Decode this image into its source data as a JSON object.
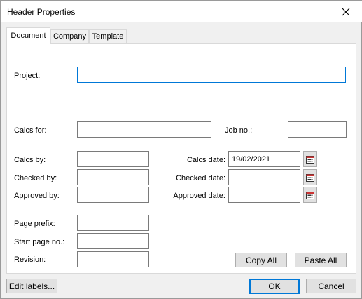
{
  "window": {
    "title": "Header Properties",
    "close_icon": "close-icon"
  },
  "tabs": [
    {
      "label": "Document",
      "active": true
    },
    {
      "label": "Company",
      "active": false
    },
    {
      "label": "Template",
      "active": false
    }
  ],
  "fields": {
    "project": {
      "label": "Project:",
      "value": ""
    },
    "calcs_for": {
      "label": "Calcs for:",
      "value": ""
    },
    "job_no": {
      "label": "Job no.:",
      "value": ""
    },
    "calcs_by": {
      "label": "Calcs by:",
      "value": ""
    },
    "checked_by": {
      "label": "Checked by:",
      "value": ""
    },
    "approved_by": {
      "label": "Approved by:",
      "value": ""
    },
    "calcs_date": {
      "label": "Calcs date:",
      "value": "19/02/2021"
    },
    "checked_date": {
      "label": "Checked date:",
      "value": ""
    },
    "approved_date": {
      "label": "Approved date:",
      "value": ""
    },
    "page_prefix": {
      "label": "Page prefix:",
      "value": ""
    },
    "start_page_no": {
      "label": "Start page no.:",
      "value": ""
    },
    "revision": {
      "label": "Revision:",
      "value": ""
    }
  },
  "buttons": {
    "copy_all": "Copy All",
    "paste_all": "Paste All",
    "edit_labels": "Edit labels...",
    "ok": "OK",
    "cancel": "Cancel"
  },
  "colors": {
    "focus": "#0078d7",
    "calendar_accent": "#cc3333"
  }
}
